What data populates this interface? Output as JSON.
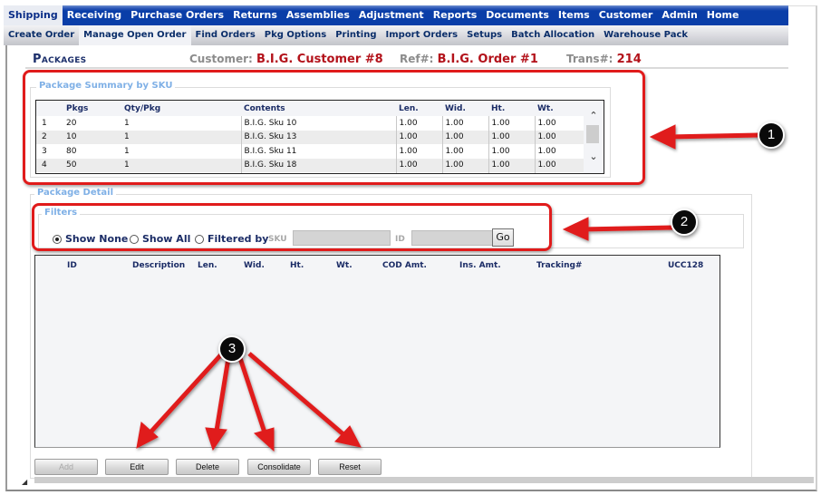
{
  "menu": {
    "items": [
      {
        "label": "Shipping",
        "active": true
      },
      {
        "label": "Receiving"
      },
      {
        "label": "Purchase Orders"
      },
      {
        "label": "Returns"
      },
      {
        "label": "Assemblies"
      },
      {
        "label": "Adjustment"
      },
      {
        "label": "Reports"
      },
      {
        "label": "Documents"
      },
      {
        "label": "Items"
      },
      {
        "label": "Customer"
      },
      {
        "label": "Admin"
      },
      {
        "label": "Home"
      }
    ]
  },
  "submenu": {
    "items": [
      {
        "label": "Create Order"
      },
      {
        "label": "Manage Open Order",
        "active": true
      },
      {
        "label": "Find Orders"
      },
      {
        "label": "Pkg Options"
      },
      {
        "label": "Printing"
      },
      {
        "label": "Import Orders"
      },
      {
        "label": "Setups"
      },
      {
        "label": "Batch Allocation"
      },
      {
        "label": "Warehouse Pack"
      }
    ]
  },
  "header": {
    "title": "Packages",
    "customer_label": "Customer:",
    "customer_value": "B.I.G. Customer #8",
    "ref_label": "Ref#:",
    "ref_value": "B.I.G. Order #1",
    "trans_label": "Trans#:",
    "trans_value": "214"
  },
  "summary": {
    "legend": "Package Summary by SKU",
    "columns": [
      "",
      "Pkgs",
      "Qty/Pkg",
      "Contents",
      "Len.",
      "Wid.",
      "Ht.",
      "Wt."
    ],
    "rows": [
      [
        "1",
        "20",
        "1",
        "B.I.G. Sku 10",
        "1.00",
        "1.00",
        "1.00",
        "1.00"
      ],
      [
        "2",
        "10",
        "1",
        "B.I.G. Sku 13",
        "1.00",
        "1.00",
        "1.00",
        "1.00"
      ],
      [
        "3",
        "80",
        "1",
        "B.I.G. Sku 11",
        "1.00",
        "1.00",
        "1.00",
        "1.00"
      ],
      [
        "4",
        "50",
        "1",
        "B.I.G. Sku 18",
        "1.00",
        "1.00",
        "1.00",
        "1.00"
      ]
    ]
  },
  "detail": {
    "legend": "Package Detail",
    "filters": {
      "legend": "Filters",
      "options": [
        "Show None",
        "Show All",
        "Filtered by"
      ],
      "selected": "Show None",
      "sku_label": "SKU",
      "sku_value": "",
      "id_label": "ID",
      "id_value": "",
      "go_label": "Go"
    },
    "columns": [
      "ID",
      "Description",
      "Len.",
      "Wid.",
      "Ht.",
      "Wt.",
      "COD Amt.",
      "Ins. Amt.",
      "Tracking#",
      "UCC128"
    ],
    "rows": []
  },
  "buttons": {
    "add": "Add",
    "edit": "Edit",
    "delete": "Delete",
    "consolidate": "Consolidate",
    "reset": "Reset"
  },
  "annotations": {
    "callouts": [
      "1",
      "2",
      "3"
    ],
    "highlight_color": "#e01b1b"
  }
}
